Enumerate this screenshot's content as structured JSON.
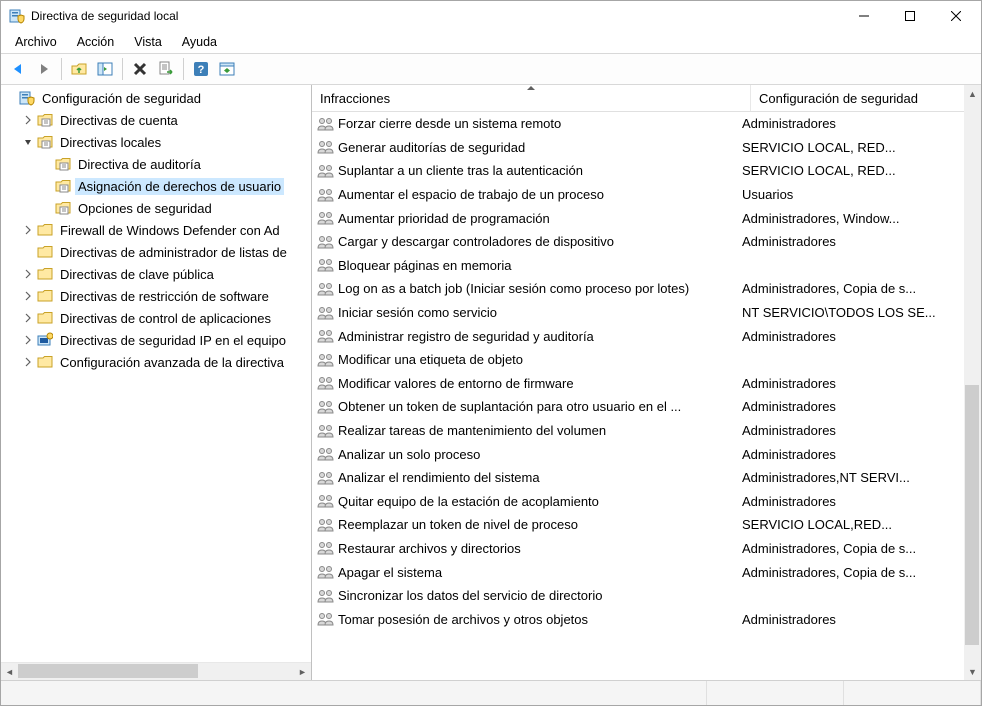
{
  "window": {
    "title": "Directiva de seguridad local"
  },
  "menu": {
    "items": [
      "Archivo",
      "Acción",
      "Vista",
      "Ayuda"
    ]
  },
  "toolbar": {
    "buttons": [
      {
        "name": "back-icon",
        "title": "Atrás"
      },
      {
        "name": "forward-icon",
        "title": "Adelante"
      },
      {
        "sep": true
      },
      {
        "name": "up-folder-icon",
        "title": "Subir un nivel"
      },
      {
        "name": "show-hide-tree-icon",
        "title": "Mostrar/ocultar árbol"
      },
      {
        "sep": true
      },
      {
        "name": "delete-icon",
        "title": "Eliminar"
      },
      {
        "name": "export-list-icon",
        "title": "Exportar lista"
      },
      {
        "sep": true
      },
      {
        "name": "help-icon",
        "title": "Ayuda"
      },
      {
        "name": "properties-icon",
        "title": "Propiedades"
      }
    ]
  },
  "tree": {
    "root_label": "Configuración de seguridad",
    "nodes": [
      {
        "depth": 1,
        "exp": ">",
        "icon": "folder",
        "label": "Directivas de cuenta",
        "sel": false
      },
      {
        "depth": 1,
        "exp": "v",
        "icon": "folder",
        "label": "Directivas locales",
        "sel": false
      },
      {
        "depth": 2,
        "exp": "",
        "icon": "folder",
        "label": "Directiva de auditoría",
        "sel": false
      },
      {
        "depth": 2,
        "exp": "",
        "icon": "folder",
        "label": "Asignación de derechos de usuario",
        "sel": true
      },
      {
        "depth": 2,
        "exp": "",
        "icon": "folder",
        "label": "Opciones de seguridad",
        "sel": false
      },
      {
        "depth": 1,
        "exp": ">",
        "icon": "folder-plain",
        "label": "Firewall de Windows Defender con Ad",
        "sel": false
      },
      {
        "depth": 1,
        "exp": "",
        "icon": "folder-plain",
        "label": "Directivas de administrador de listas de",
        "sel": false
      },
      {
        "depth": 1,
        "exp": ">",
        "icon": "folder-plain",
        "label": "Directivas de clave pública",
        "sel": false
      },
      {
        "depth": 1,
        "exp": ">",
        "icon": "folder-plain",
        "label": "Directivas de restricción de software",
        "sel": false
      },
      {
        "depth": 1,
        "exp": ">",
        "icon": "folder-plain",
        "label": "Directivas de control de aplicaciones",
        "sel": false
      },
      {
        "depth": 1,
        "exp": ">",
        "icon": "ipsec",
        "label": "Directivas de seguridad IP en el equipo",
        "sel": false
      },
      {
        "depth": 1,
        "exp": ">",
        "icon": "folder-plain",
        "label": "Configuración avanzada de la directiva",
        "sel": false
      }
    ]
  },
  "list": {
    "columns": [
      "Infracciones",
      "Configuración de seguridad"
    ],
    "rows": [
      {
        "name": "Forzar cierre desde un sistema remoto",
        "cfg": "Administradores"
      },
      {
        "name": "Generar auditorías de seguridad",
        "cfg": "SERVICIO LOCAL, RED..."
      },
      {
        "name": "Suplantar a un cliente tras la autenticación",
        "cfg": "SERVICIO LOCAL, RED..."
      },
      {
        "name": "Aumentar el espacio de trabajo de un proceso",
        "cfg": "Usuarios"
      },
      {
        "name": "Aumentar prioridad de programación",
        "cfg": "Administradores, Window..."
      },
      {
        "name": "Cargar y descargar controladores de dispositivo",
        "cfg": "Administradores"
      },
      {
        "name": "Bloquear páginas en memoria",
        "cfg": ""
      },
      {
        "name": "Log on as a batch job (Iniciar sesión como proceso por lotes)",
        "cfg": "Administradores, Copia de s..."
      },
      {
        "name": "Iniciar sesión como servicio",
        "cfg": "NT SERVICIO\\TODOS LOS SE..."
      },
      {
        "name": "Administrar registro de seguridad y auditoría",
        "cfg": "Administradores"
      },
      {
        "name": "Modificar una etiqueta de objeto",
        "cfg": ""
      },
      {
        "name": "Modificar valores de entorno de firmware",
        "cfg": "Administradores"
      },
      {
        "name": "Obtener un token de suplantación para otro usuario en el ...",
        "cfg": "Administradores"
      },
      {
        "name": "Realizar tareas de mantenimiento del volumen",
        "cfg": "Administradores"
      },
      {
        "name": "Analizar un solo proceso",
        "cfg": "Administradores"
      },
      {
        "name": "Analizar el rendimiento del sistema",
        "cfg": "Administradores,NT SERVI..."
      },
      {
        "name": "Quitar equipo de la estación de acoplamiento",
        "cfg": "Administradores"
      },
      {
        "name": "Reemplazar un token de nivel de proceso",
        "cfg": "SERVICIO LOCAL,RED..."
      },
      {
        "name": "Restaurar archivos y directorios",
        "cfg": "Administradores, Copia de s..."
      },
      {
        "name": "Apagar el sistema",
        "cfg": "Administradores, Copia de s..."
      },
      {
        "name": "Sincronizar los datos del servicio de directorio",
        "cfg": ""
      },
      {
        "name": "Tomar posesión de archivos y otros objetos",
        "cfg": "Administradores"
      }
    ]
  }
}
